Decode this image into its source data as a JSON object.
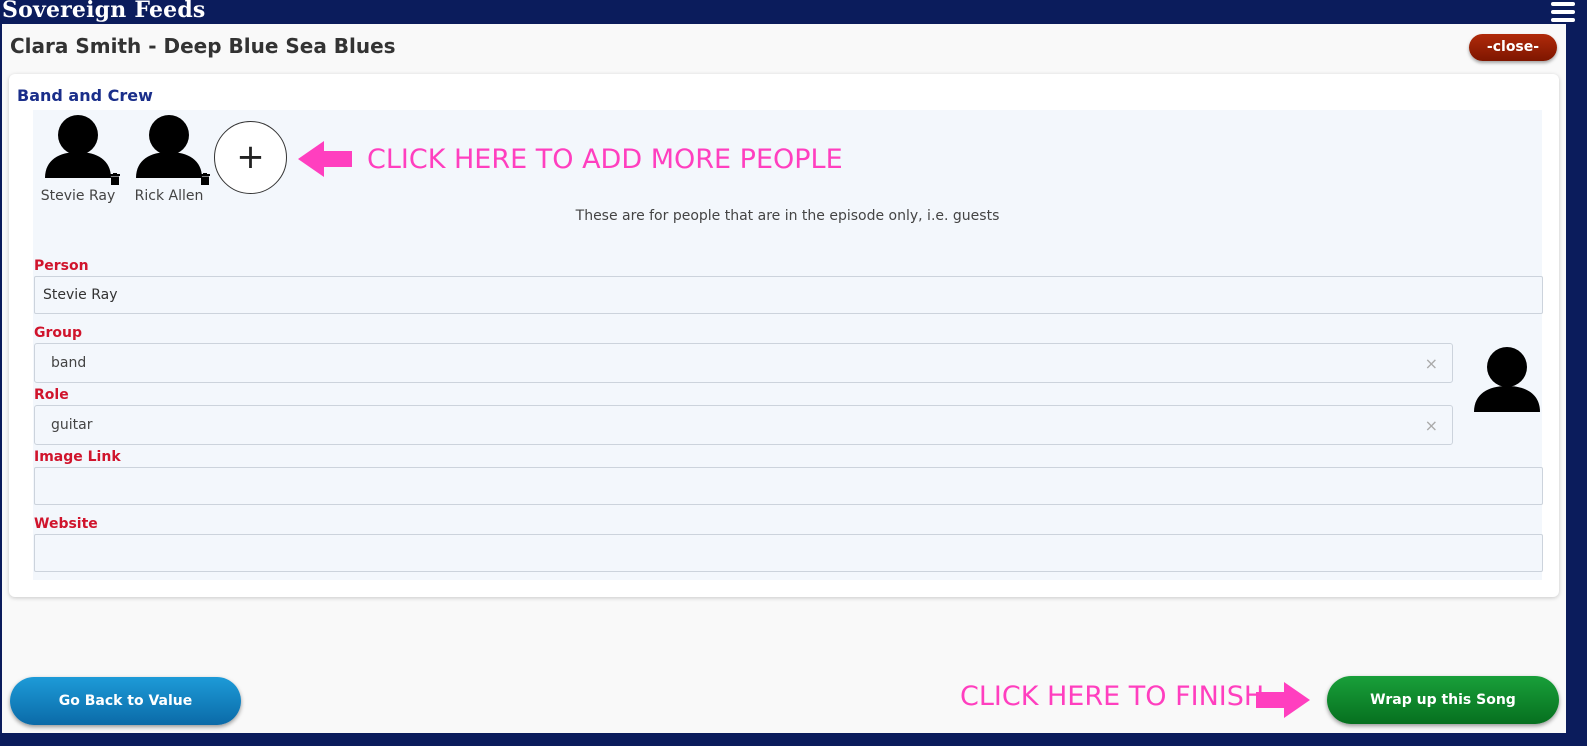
{
  "app": {
    "title": "Sovereign Feeds"
  },
  "header": {
    "title": "Clara Smith - Deep Blue Sea Blues",
    "close_label": "-close-"
  },
  "section": {
    "title": "Band and Crew"
  },
  "people": [
    {
      "name": "Stevie Ray"
    },
    {
      "name": "Rick Allen"
    }
  ],
  "add_button": {
    "label": "+"
  },
  "annotations": {
    "add_people": "CLICK HERE TO ADD MORE PEOPLE",
    "finish": "CLICK HERE TO FINISH"
  },
  "note": "These are for people that are in the episode only, i.e. guests",
  "form": {
    "person_label": "Person",
    "person_value": "Stevie Ray",
    "group_label": "Group",
    "group_value": "band",
    "role_label": "Role",
    "role_value": "guitar",
    "image_link_label": "Image Link",
    "image_link_value": "",
    "website_label": "Website",
    "website_value": "",
    "clear_glyph": "×"
  },
  "footer": {
    "back_label": "Go Back to Value",
    "wrap_label": "Wrap up this Song"
  },
  "colors": {
    "navy": "#0b1c5c",
    "label_red": "#d0142c",
    "annotation_pink": "#ff3fbf",
    "close_red": "#9a1d05",
    "wrap_green": "#0d8a2c",
    "back_blue": "#1487c8"
  }
}
